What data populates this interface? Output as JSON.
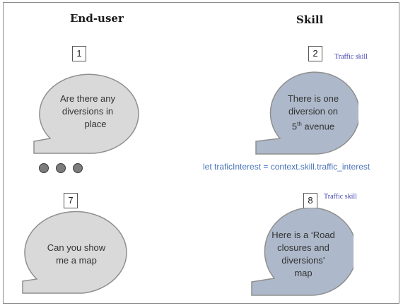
{
  "headings": {
    "end_user": "End-user",
    "skill": "Skill"
  },
  "steps": [
    {
      "number": "1"
    },
    {
      "number": "2",
      "tag": "Traffic skill"
    },
    {
      "number": "7"
    },
    {
      "number": "8",
      "tag": "Traffic skill"
    }
  ],
  "bubbles": {
    "user_1": {
      "lines": [
        "Are there any",
        "diversions in",
        "place"
      ],
      "fill": "#d9d9d9"
    },
    "skill_2": {
      "lines": [
        "There is one",
        "diversion on"
      ],
      "last_pre": "5",
      "last_sup": "th",
      "last_post": " avenue",
      "fill": "#adb9ca"
    },
    "user_7": {
      "lines": [
        "Can you show",
        "me a map"
      ],
      "fill": "#d9d9d9"
    },
    "skill_8": {
      "lines": [
        "Here is a ‘Road",
        "closures and",
        "diversions’",
        "map"
      ],
      "fill": "#adb9ca"
    }
  },
  "code_line": "let traficInterest = context.skill.traffic_interest",
  "colors": {
    "bubble_outline": "#8f8f8f",
    "code_text": "#4a74b8",
    "tag_text": "#3f3fb0"
  }
}
